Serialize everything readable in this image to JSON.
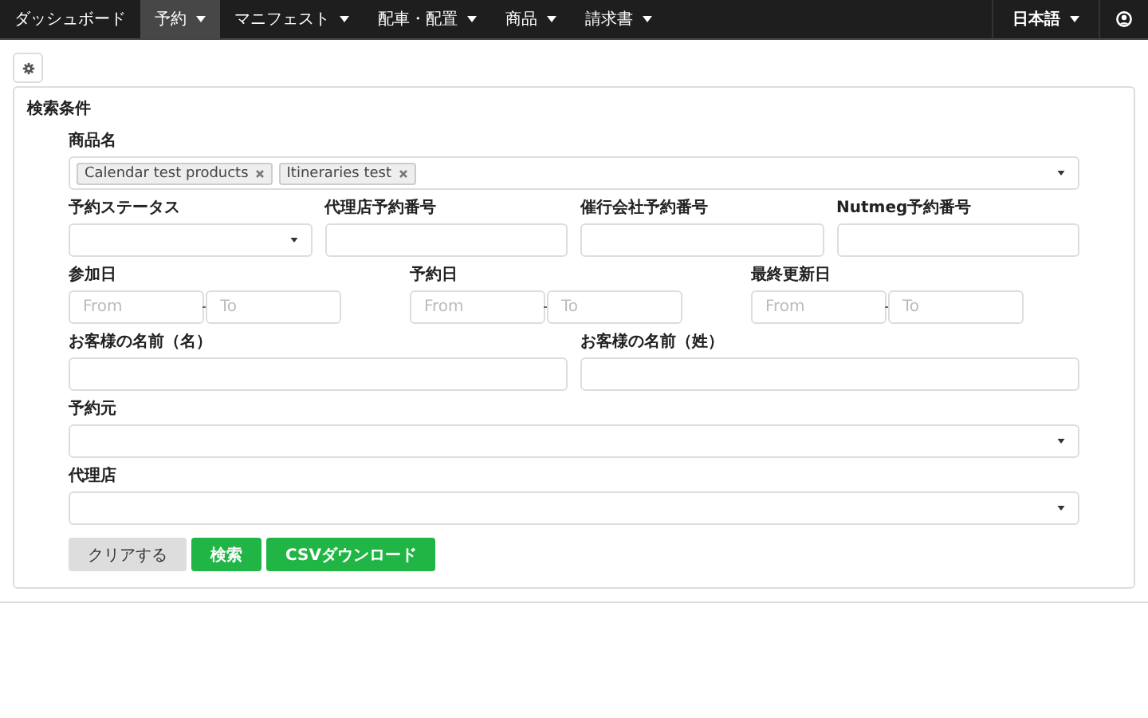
{
  "nav": {
    "items": [
      {
        "label": "ダッシュボード",
        "selected": false,
        "has_menu": false
      },
      {
        "label": "予約",
        "selected": true,
        "has_menu": true
      },
      {
        "label": "マニフェスト",
        "selected": false,
        "has_menu": true
      },
      {
        "label": "配車・配置",
        "selected": false,
        "has_menu": true
      },
      {
        "label": "商品",
        "selected": false,
        "has_menu": true
      },
      {
        "label": "請求書",
        "selected": false,
        "has_menu": true
      }
    ],
    "language": {
      "label": "日本語",
      "has_menu": true
    }
  },
  "panel": {
    "title": "検索条件",
    "form_lines": [
      {
        "fields": [
          {
            "kind": "tags",
            "label": "商品名",
            "tags": [
              "Calendar test products",
              "Itineraries test"
            ]
          }
        ]
      },
      {
        "fields": [
          {
            "kind": "select",
            "label": "予約ステータス"
          },
          {
            "kind": "text",
            "label": "代理店予約番号"
          },
          {
            "kind": "text",
            "label": "催行会社予約番号"
          },
          {
            "kind": "text",
            "label": "Nutmeg予約番号"
          }
        ]
      },
      {
        "fields": [
          {
            "kind": "daterange",
            "label": "参加日",
            "from": {
              "placeholder": "From"
            },
            "to": {
              "placeholder": "To"
            }
          },
          {
            "kind": "daterange",
            "label": "予約日",
            "from": {
              "placeholder": "From"
            },
            "to": {
              "placeholder": "To"
            }
          },
          {
            "kind": "daterange",
            "label": "最終更新日",
            "from": {
              "placeholder": "From"
            },
            "to": {
              "placeholder": "To"
            }
          }
        ]
      },
      {
        "fields": [
          {
            "kind": "text",
            "label": "お客様の名前（名）"
          },
          {
            "kind": "text",
            "label": "お客様の名前（姓）"
          }
        ]
      },
      {
        "fields": [
          {
            "kind": "select",
            "label": "予約元"
          }
        ]
      },
      {
        "fields": [
          {
            "kind": "select",
            "label": "代理店"
          }
        ]
      }
    ],
    "buttons": [
      {
        "label": "クリアする",
        "kind": "default"
      },
      {
        "label": "検索",
        "kind": "primary"
      },
      {
        "label": "CSVダウンロード",
        "kind": "primary"
      }
    ]
  }
}
